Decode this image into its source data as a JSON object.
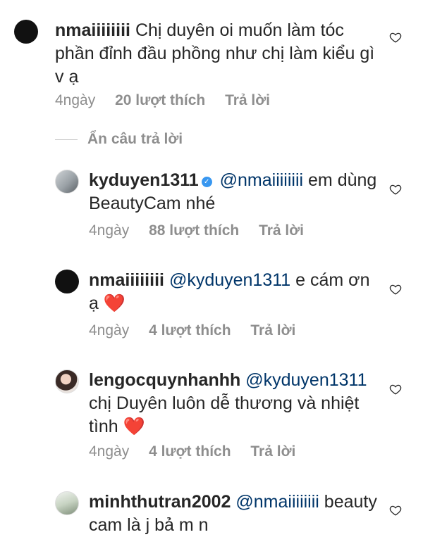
{
  "comments": [
    {
      "username": "nmaiiiiiiii",
      "text": "Chị duyên oi muốn làm tóc phần đỉnh đầu phồng như chị làm kiểu gì v ạ",
      "time": "4ngày",
      "likes": "20 lượt thích",
      "reply": "Trả lời"
    },
    {
      "username": "kyduyen1311",
      "verified": true,
      "mention": "@nmaiiiiiiii",
      "text": "em dùng BeautyCam nhé",
      "time": "4ngày",
      "likes": "88 lượt thích",
      "reply": "Trả lời"
    },
    {
      "username": "nmaiiiiiiii",
      "mention": "@kyduyen1311",
      "text": "e cám ơn ạ",
      "emoji": "❤️",
      "time": "4ngày",
      "likes": "4 lượt thích",
      "reply": "Trả lời"
    },
    {
      "username": "lengocquynhanhh",
      "mention": "@kyduyen1311",
      "text": "chị Duyên luôn dễ thương và nhiệt tình",
      "emoji": "❤️",
      "time": "4ngày",
      "likes": "4 lượt thích",
      "reply": "Trả lời"
    },
    {
      "username": "minhthutran2002",
      "mention": "@nmaiiiiiiii",
      "text": "beauty cam là j bả m n"
    }
  ],
  "hide_replies": "Ẩn câu trả lời",
  "icons": {
    "like": "heart-outline-icon",
    "verified": "verified-badge-icon"
  },
  "colors": {
    "verified": "#3897f0",
    "mention": "#003569",
    "meta": "#8e8e8e"
  }
}
